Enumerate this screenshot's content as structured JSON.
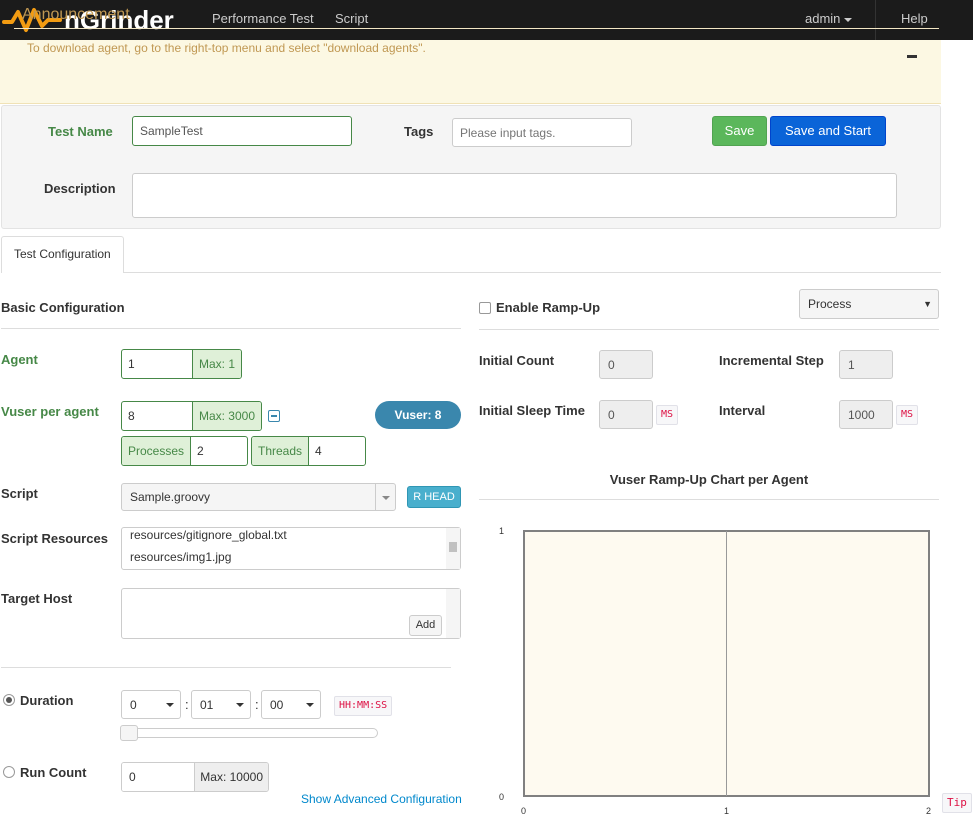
{
  "navbar": {
    "logo": "nGrinder",
    "links": [
      "Performance Test",
      "Script"
    ],
    "user": "admin",
    "help": "Help"
  },
  "announcement": {
    "title": "Announcement",
    "text": "To download agent, go to the right-top menu and select \"download agents\"."
  },
  "test_form": {
    "name_label": "Test Name",
    "name_value": "SampleTest",
    "tags_label": "Tags",
    "tags_placeholder": "Please input tags.",
    "save_label": "Save",
    "save_start_label": "Save and Start",
    "description_label": "Description",
    "description_value": ""
  },
  "tabs": [
    "Test Configuration"
  ],
  "basic": {
    "title": "Basic Configuration",
    "agent_label": "Agent",
    "agent_value": "1",
    "agent_max": "Max: 1",
    "vuser_label": "Vuser per agent",
    "vuser_value": "8",
    "vuser_max": "Max: 3000",
    "vuser_badge": "Vuser: 8",
    "processes_label": "Processes",
    "processes_value": "2",
    "threads_label": "Threads",
    "threads_value": "4",
    "script_label": "Script",
    "script_value": "Sample.groovy",
    "rhead_label": "R HEAD",
    "resources_label": "Script Resources",
    "resources": [
      "resources/gitignore_global.txt",
      "resources/img1.jpg"
    ],
    "target_host_label": "Target Host",
    "add_label": "Add",
    "duration_label": "Duration",
    "duration_hours": "0",
    "duration_minutes": "01",
    "duration_seconds": "00",
    "duration_format": "HH:MM:SS",
    "runcount_label": "Run Count",
    "runcount_value": "0",
    "runcount_max": "Max: 10000",
    "advanced_link": "Show Advanced Configuration"
  },
  "rampup": {
    "enable_label": "Enable Ramp-Up",
    "enabled": false,
    "mode": "Process",
    "initial_count_label": "Initial Count",
    "initial_count": "0",
    "incremental_step_label": "Incremental Step",
    "incremental_step": "1",
    "initial_sleep_label": "Initial Sleep Time",
    "initial_sleep": "0",
    "interval_label": "Interval",
    "interval": "1000",
    "unit": "MS",
    "chart_title": "Vuser Ramp-Up Chart per Agent",
    "tip": "Tip"
  },
  "chart_data": {
    "type": "line",
    "title": "Vuser Ramp-Up Chart per Agent",
    "x_ticks": [
      "0",
      "1",
      "2"
    ],
    "y_ticks": [
      "0",
      "1"
    ],
    "xlim": [
      0,
      2
    ],
    "ylim": [
      0,
      1
    ],
    "series": []
  }
}
